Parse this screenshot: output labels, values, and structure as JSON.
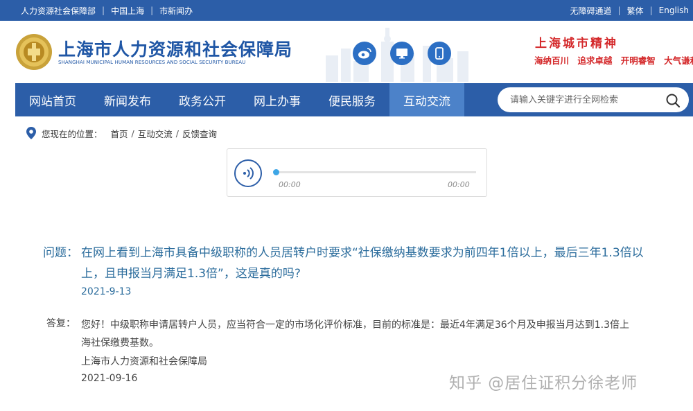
{
  "topbar": {
    "links_left": [
      "人力资源社会保障部",
      "中国上海",
      "市新闻办"
    ],
    "links_right": [
      "无障碍通道",
      "繁体",
      "English"
    ]
  },
  "header": {
    "title": "上海市人力资源和社会保障局",
    "subtitle": "SHANGHAI MUNICIPAL HUMAN RESOURCES AND SOCIAL SECURITY BUREAU",
    "social_icons": [
      "weibo-icon",
      "monitor-icon",
      "mobile-icon"
    ],
    "spirit": {
      "title": "上海城市精神",
      "phrases": [
        "海纳百川",
        "追求卓越",
        "开明睿智",
        "大气谦和"
      ]
    }
  },
  "nav": {
    "items": [
      "网站首页",
      "新闻发布",
      "政务公开",
      "网上办事",
      "便民服务",
      "互动交流"
    ],
    "active_index": 5
  },
  "search": {
    "placeholder": "请输入关键字进行全网检索"
  },
  "breadcrumb": {
    "label": "您现在的位置：",
    "items": [
      "首页",
      "互动交流",
      "反馈查询"
    ]
  },
  "audio": {
    "current_time": "00:00",
    "total_time": "00:00",
    "progress": 0
  },
  "qa": {
    "question_label": "问题：",
    "question_text": "在网上看到上海市具备中级职称的人员居转户时要求“社保缴纳基数要求为前四年1倍以上，最后三年1.3倍以上，且申报当月满足1.3倍”，这是真的吗?",
    "question_date": "2021-9-13",
    "answer_label": "答复：",
    "answer_text": "您好！中级职称申请居转户人员，应当符合一定的市场化评价标准，目前的标准是：最近4年满足36个月及申报当月达到1.3倍上海社保缴费基数。",
    "answer_org": "上海市人力资源和社会保障局",
    "answer_date": "2021-09-16"
  },
  "watermark": "知乎 @居住证积分徐老师",
  "colors": {
    "brand_blue": "#2c5ea8",
    "nav_active": "#4c82c9",
    "question_text": "#2b6c9c",
    "spirit_red": "#d4282a",
    "progress_knob": "#3ea6e6"
  }
}
